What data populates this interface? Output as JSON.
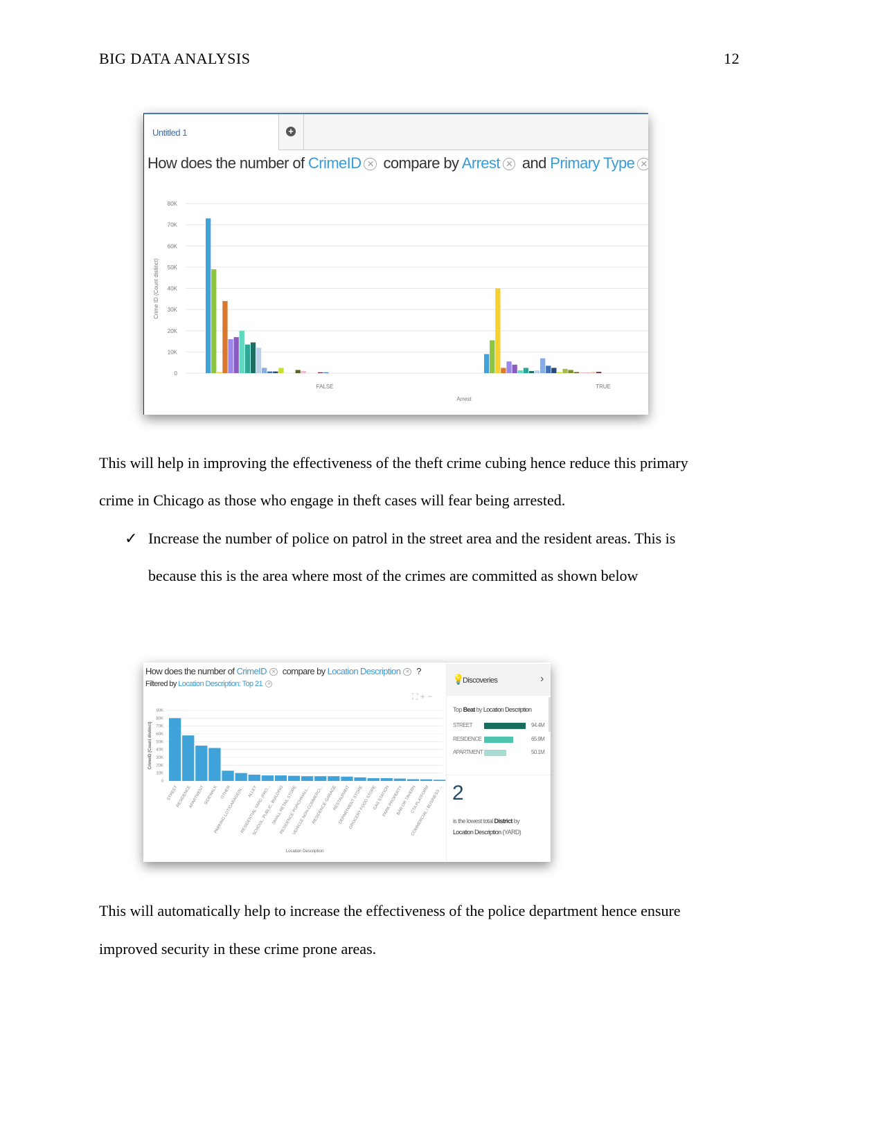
{
  "header": {
    "running_head": "BIG DATA ANALYSIS",
    "page_number": "12"
  },
  "figure1": {
    "tab_label": "Untitled 1",
    "add_tab_icon": "plus-circle-icon",
    "question": {
      "p1": "How does the number of",
      "kw1": "CrimeID",
      "p2": "compare by",
      "kw2": "Arrest",
      "p3": "and",
      "kw3": "Primary Type",
      "p4": "?"
    },
    "chart_data": {
      "type": "bar",
      "xlabel": "Arrest",
      "ylabel": "Crime ID (Count distinct)",
      "categories": [
        "FALSE",
        "TRUE"
      ],
      "ylim": [
        0,
        80000
      ],
      "yticks": [
        "0",
        "10K",
        "20K",
        "30K",
        "40K",
        "50K",
        "60K",
        "70K",
        "80K"
      ],
      "grid": true,
      "series_colors": [
        "#3fa3d9",
        "#8cc63f",
        "#f7cf2f",
        "#d9782e",
        "#9b88e8",
        "#8a5cc0",
        "#5fd8c0",
        "#2fa595",
        "#1f6e64",
        "#bfcfea",
        "#86aee3",
        "#3f6fb8",
        "#2b4a7a",
        "#c8dc34",
        "#a9b84a",
        "#7e8f2a",
        "#5a6420",
        "#f0b8c8",
        "#e8a0a8",
        "#f5c0b0",
        "#7a2050",
        "#3f86c8"
      ],
      "series_values": {
        "FALSE": [
          73000,
          49000,
          500,
          34000,
          16000,
          17000,
          20000,
          13500,
          14500,
          12000,
          2500,
          800,
          800,
          2500,
          0,
          0,
          1500,
          1000,
          0,
          0,
          400,
          400
        ],
        "TRUE": [
          9000,
          15500,
          40000,
          2500,
          5500,
          4000,
          1300,
          2500,
          1000,
          1300,
          7000,
          3500,
          2500,
          500,
          2000,
          1500,
          500,
          300,
          300,
          500,
          600,
          0
        ]
      }
    }
  },
  "body": {
    "p1_line1": "This will help in improving the effectiveness of the theft crime cubing hence reduce this primary",
    "p1_line2": "crime in Chicago as those who engage in theft cases will fear being arrested.",
    "bullet_icon": "checkmark-icon",
    "bullet_line1": "Increase the number of police on patrol in the street area and the resident areas. This is",
    "bullet_line2": "because this is the area where most of the crimes are committed as shown below",
    "p2_line1": "This will automatically help to increase the effectiveness of the police department hence ensure",
    "p2_line2": "improved security in these crime prone areas."
  },
  "figure2": {
    "question": {
      "p1": "How does the number of",
      "kw1": "CrimeID",
      "p2": "compare by",
      "kw2": "Location Description",
      "p4": "?"
    },
    "filter": {
      "label": "Filtered by",
      "value": "Location Description: Top 21"
    },
    "chart_data": {
      "type": "bar",
      "xlabel": "Location Description",
      "ylabel": "CrimeID (Count distinct)",
      "ylim": [
        0,
        90000
      ],
      "yticks": [
        "0",
        "10K",
        "20K",
        "30K",
        "40K",
        "50K",
        "60K",
        "70K",
        "80K",
        "90K"
      ],
      "grid": true,
      "bar_color": "#3fa3d9",
      "categories": [
        "STREET",
        "RESIDENCE",
        "APARTMENT",
        "SIDEWALK",
        "OTHER",
        "PARKING LOT/GARAGE(N...",
        "ALLEY",
        "RESIDENTIAL YARD (FRO...",
        "SCHOOL, PUBLIC, BUILDING",
        "SMALL RETAIL STORE",
        "RESIDENCE PORCH/HALL...",
        "VEHICLE NON-COMMERCI...",
        "RESIDENCE-GARAGE",
        "RESTAURANT",
        "DEPARTMENT STORE",
        "GROCERY FOOD STORE",
        "GAS STATION",
        "PARK PROPERTY",
        "BAR OR TAVERN",
        "CTA PLATFORM",
        "COMMERCIAL / BUSINESS ..."
      ],
      "values": [
        80000,
        58000,
        45000,
        42000,
        13000,
        10000,
        8000,
        7000,
        7000,
        6500,
        6000,
        6000,
        6000,
        5500,
        4500,
        3500,
        3500,
        3000,
        2200,
        2000,
        1500
      ]
    },
    "discoveries": {
      "title": "Discoveries",
      "icon": "lightbulb-icon",
      "chevron_icon": "chevron-right-icon",
      "top_beat": {
        "p1": "Top",
        "b1": "Beat",
        "p2": "by",
        "b2": "Location Description"
      },
      "rows": [
        {
          "label": "STREET",
          "value": "94.4M",
          "fraction": 1.0,
          "color": "#1b6e5c"
        },
        {
          "label": "RESIDENCE",
          "value": "65.9M",
          "fraction": 0.7,
          "color": "#4ec4b0"
        },
        {
          "label": "APARTMENT",
          "value": "50.1M",
          "fraction": 0.53,
          "color": "#a8dcd2"
        }
      ],
      "insight": {
        "number": "2",
        "p1": "is the lowest total",
        "b1": "District",
        "p2": "by",
        "b2": "Location Description",
        "p3": "(YARD)"
      }
    }
  }
}
